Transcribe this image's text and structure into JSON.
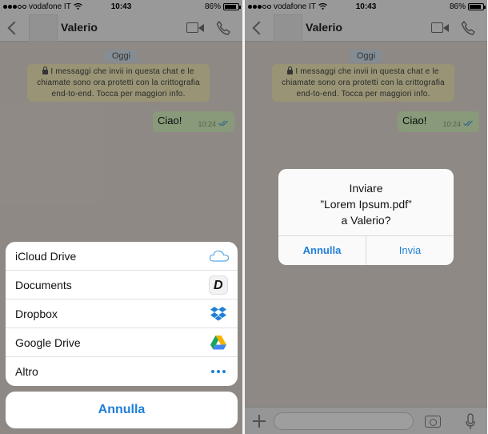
{
  "status": {
    "carrier": "vodafone IT",
    "time": "10:43",
    "battery": "86%",
    "battery_level": 0.86
  },
  "chat": {
    "contact_name": "Valerio",
    "day_label": "Oggi",
    "encryption_notice": "I messaggi che invii in questa chat e le chiamate sono ora protetti con la crittografia end-to-end. Tocca per maggiori info.",
    "message": {
      "text": "Ciao!",
      "time": "10:24"
    }
  },
  "action_sheet": {
    "items": [
      {
        "label": "iCloud Drive",
        "icon": "icloud-icon"
      },
      {
        "label": "Documents",
        "icon": "documents-app-icon"
      },
      {
        "label": "Dropbox",
        "icon": "dropbox-icon"
      },
      {
        "label": "Google Drive",
        "icon": "google-drive-icon"
      },
      {
        "label": "Altro",
        "icon": "more-dots-icon"
      }
    ],
    "cancel_label": "Annulla"
  },
  "alert": {
    "line1": "Inviare",
    "line2": "”Lorem Ipsum.pdf”",
    "line3": "a Valerio?",
    "cancel_label": "Annulla",
    "confirm_label": "Invia"
  },
  "colors": {
    "accent": "#1f7fd8",
    "bubble": "#dcf8c6",
    "notice": "#f6efbd",
    "chat_bg": "#e6ded6"
  }
}
